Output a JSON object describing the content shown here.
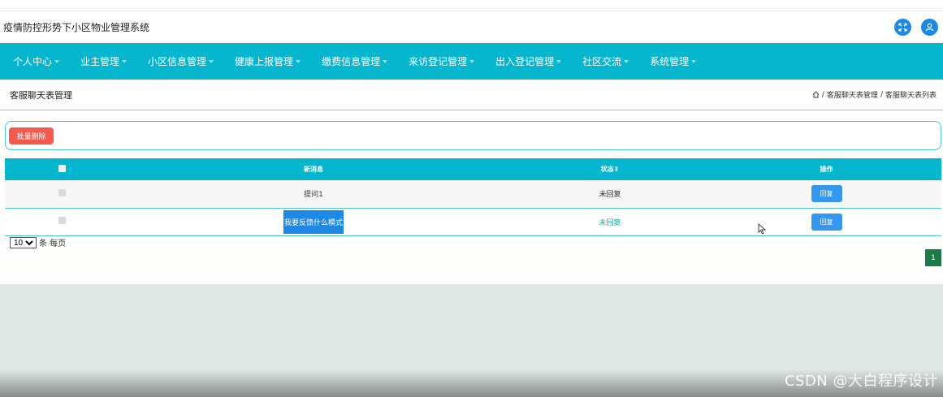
{
  "app": {
    "title": "疫情防控形势下小区物业管理系统"
  },
  "header_icons": [
    {
      "name": "fullscreen-icon"
    },
    {
      "name": "user-icon"
    }
  ],
  "nav": {
    "items": [
      {
        "label": "个人中心"
      },
      {
        "label": "业主管理"
      },
      {
        "label": "小区信息管理"
      },
      {
        "label": "健康上报管理"
      },
      {
        "label": "缴费信息管理"
      },
      {
        "label": "来访登记管理"
      },
      {
        "label": "出入登记管理"
      },
      {
        "label": "社区交流"
      },
      {
        "label": "系统管理"
      }
    ]
  },
  "page": {
    "title": "客服聊天表管理",
    "breadcrumb": [
      "客服聊天表管理",
      "客服聊天表列表"
    ]
  },
  "actions": {
    "batch_delete": "批量删除"
  },
  "table": {
    "columns": [
      "",
      "新消息",
      "状态",
      "操作"
    ],
    "sort_glyph": "⇕",
    "rows": [
      {
        "message": "提问1",
        "status": "未回复",
        "action": "回复"
      },
      {
        "message": "我要反馈什么模式",
        "status": "未回复",
        "action": "回复"
      }
    ]
  },
  "pagination": {
    "page_size": "10",
    "page_size_suffix": "条 每页",
    "current_page": "1"
  },
  "colors": {
    "nav": "#06b6cf",
    "delete_button": "#f5584c",
    "reply_button": "#3598f0",
    "pagination_active": "#1b7a48"
  },
  "watermark": "CSDN @大白程序设计"
}
